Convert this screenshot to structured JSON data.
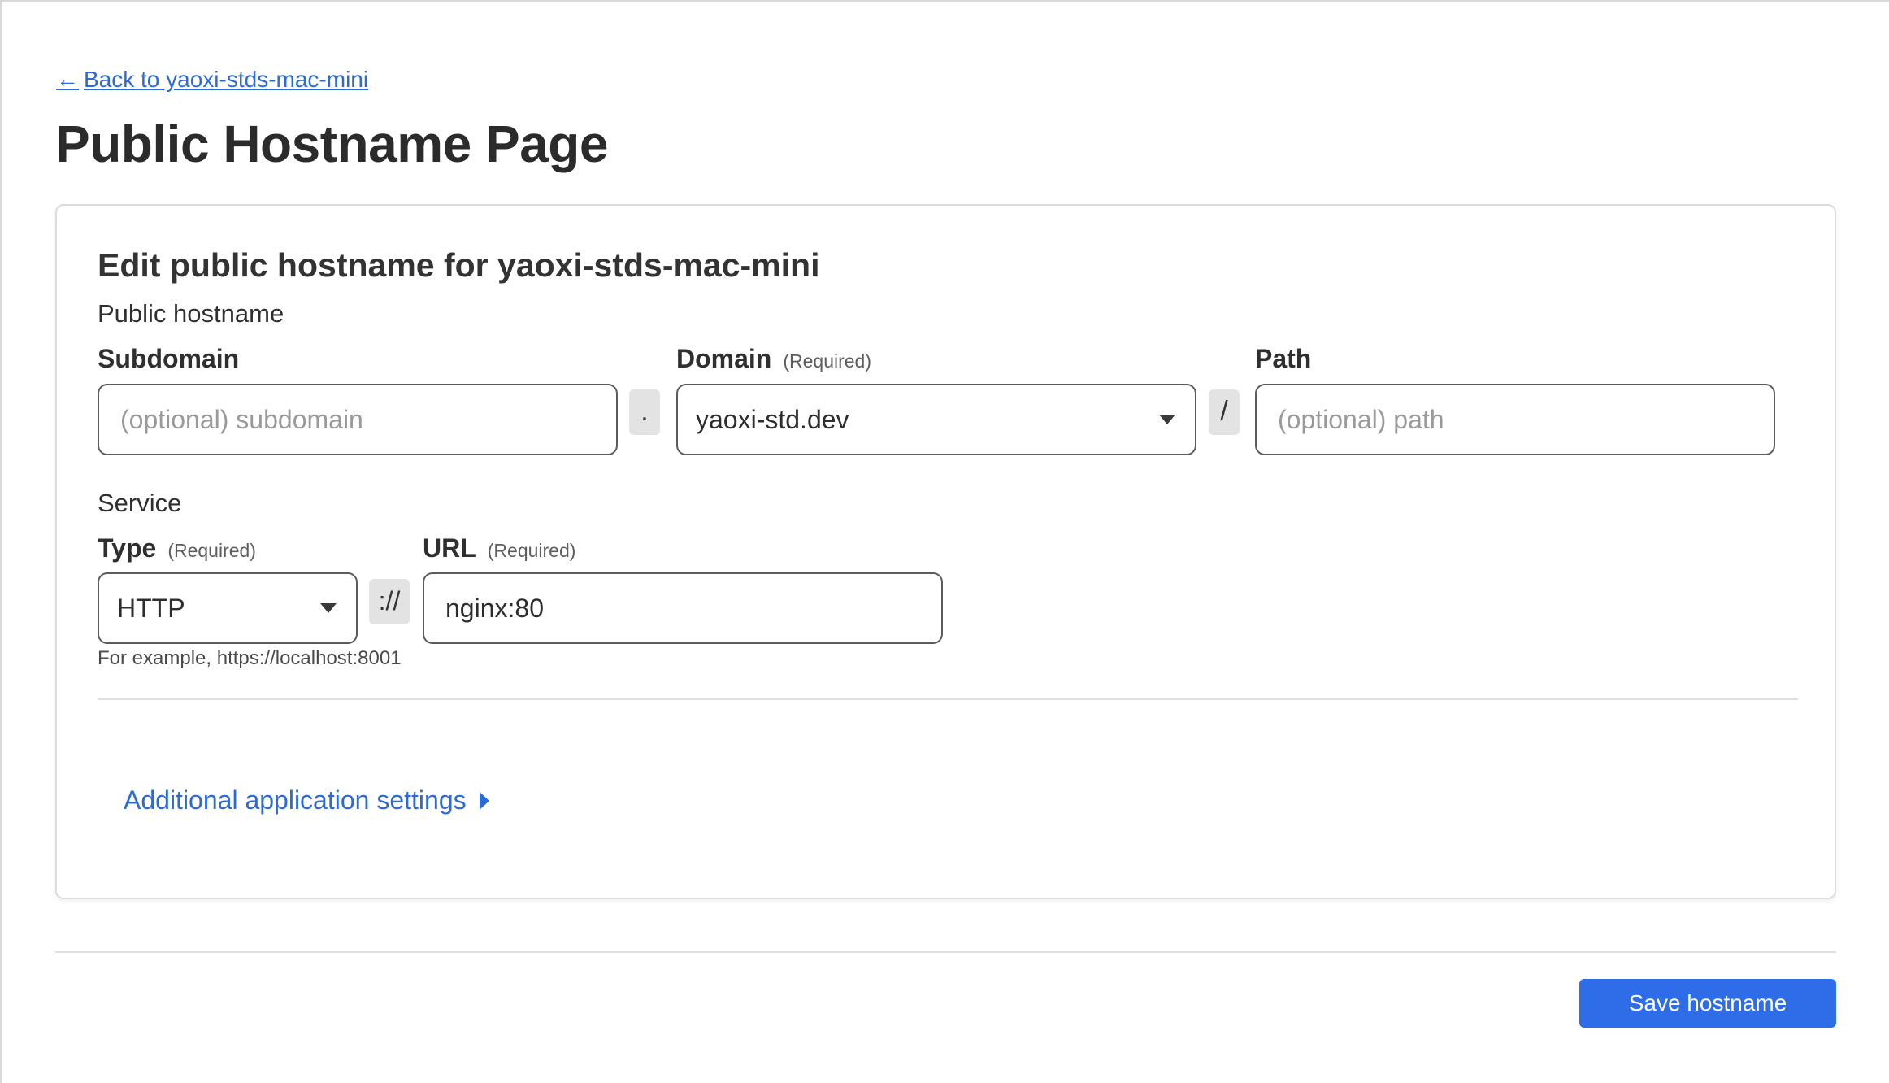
{
  "back_link": {
    "arrow": "←",
    "label": "Back to yaoxi-stds-mac-mini"
  },
  "page_title": "Public Hostname Page",
  "card": {
    "title": "Edit public hostname for yaoxi-stds-mac-mini",
    "public_hostname_section": "Public hostname",
    "subdomain": {
      "label": "Subdomain",
      "placeholder": "(optional) subdomain",
      "value": ""
    },
    "dot_separator": ".",
    "domain": {
      "label": "Domain",
      "required": "(Required)",
      "value": "yaoxi-std.dev"
    },
    "slash_separator": "/",
    "path": {
      "label": "Path",
      "placeholder": "(optional) path",
      "value": ""
    },
    "service_section": "Service",
    "type": {
      "label": "Type",
      "required": "(Required)",
      "value": "HTTP"
    },
    "scheme_separator": "://",
    "url": {
      "label": "URL",
      "required": "(Required)",
      "value": "nginx:80"
    },
    "hint": "For example, https://localhost:8001",
    "additional_settings": "Additional application settings"
  },
  "save_button": "Save hostname",
  "colors": {
    "link": "#2c6bd6",
    "primary_button": "#2f6de8"
  }
}
